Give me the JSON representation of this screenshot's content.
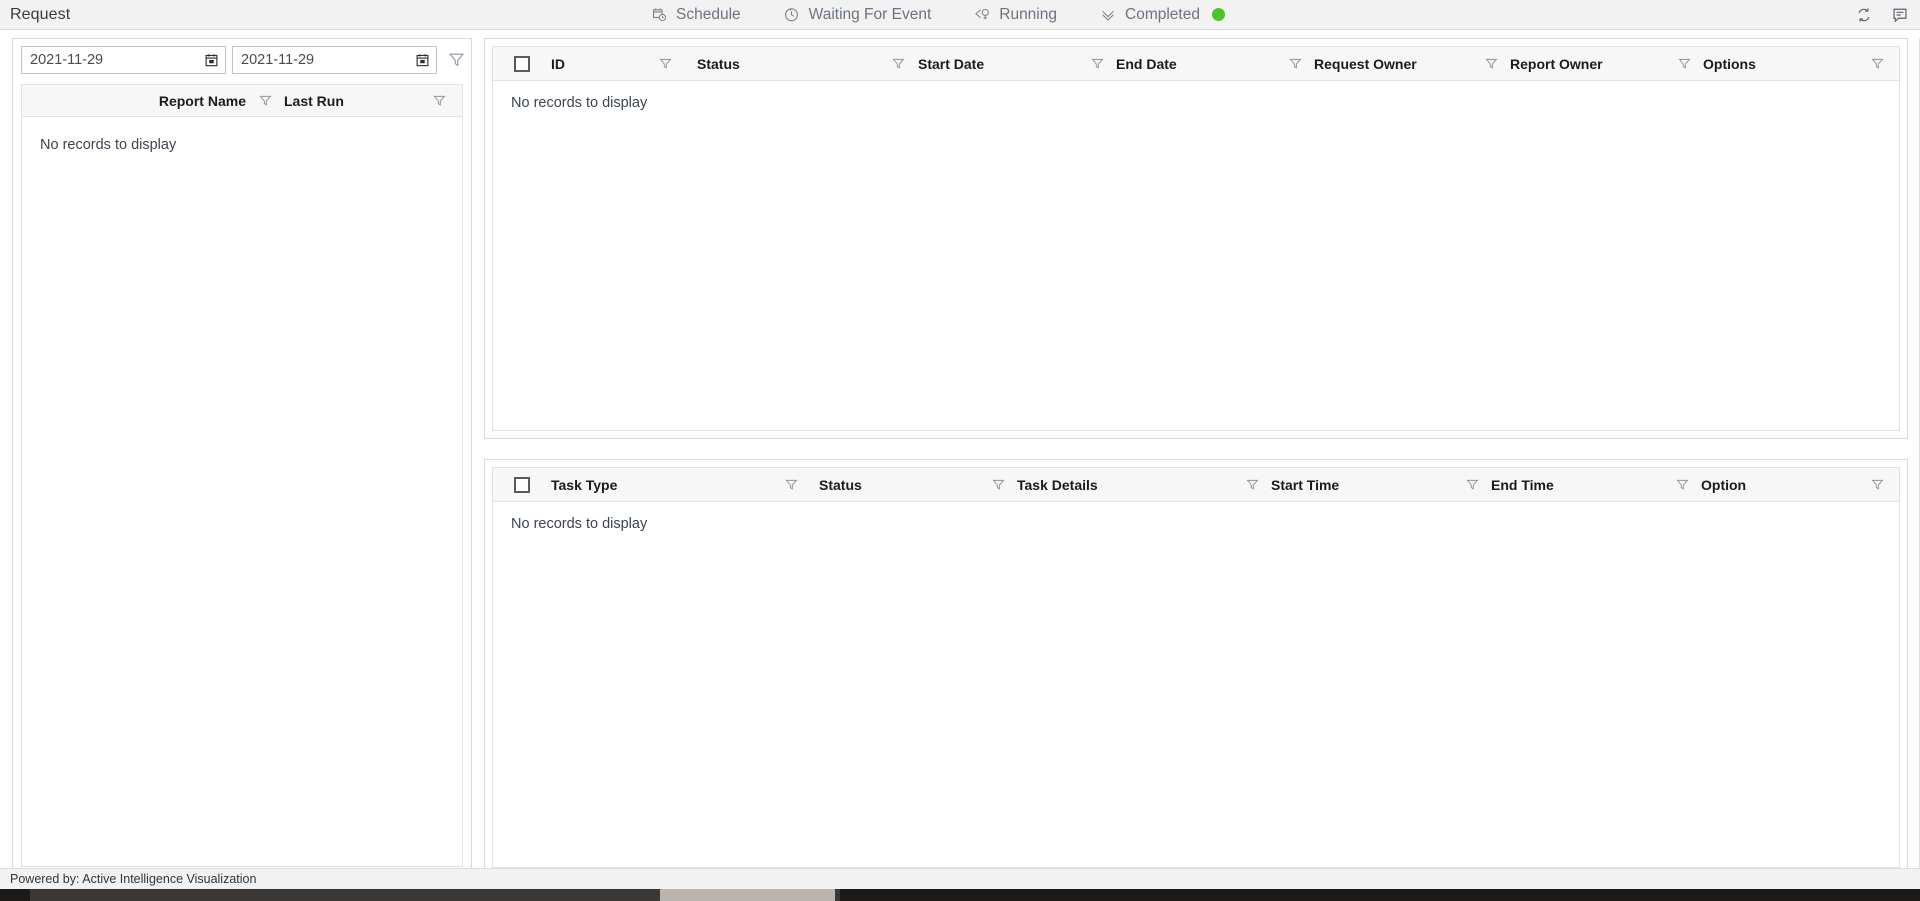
{
  "topbar": {
    "title": "Request",
    "tabs": [
      {
        "label": "Schedule",
        "icon": "calendar-clock-icon",
        "has_dot": false
      },
      {
        "label": "Waiting For Event",
        "icon": "clock-icon",
        "has_dot": false
      },
      {
        "label": "Running",
        "icon": "history-clock-icon",
        "has_dot": false
      },
      {
        "label": "Completed",
        "icon": "double-check-icon",
        "has_dot": true,
        "dot_color": "#4cc527"
      }
    ],
    "actions": [
      {
        "icon": "refresh-icon"
      },
      {
        "icon": "comment-icon"
      }
    ]
  },
  "left_panel": {
    "date_from": {
      "value": "2021-11-29",
      "placeholder": "yyyy-mm-dd"
    },
    "date_to": {
      "value": "2021-11-29",
      "placeholder": "yyyy-mm-dd"
    },
    "filter_icon": "filter-icon",
    "calendar_icon": "calendar-icon",
    "grid": {
      "columns": [
        {
          "label": "Report Name",
          "filter": true
        },
        {
          "label": "Last Run",
          "filter": true
        }
      ],
      "empty_text": "No records to display",
      "rows": []
    }
  },
  "request_grid": {
    "columns": [
      {
        "label": "ID",
        "filter": true
      },
      {
        "label": "Status",
        "filter": true
      },
      {
        "label": "Start Date",
        "filter": true
      },
      {
        "label": "End Date",
        "filter": true
      },
      {
        "label": "Request Owner",
        "filter": true
      },
      {
        "label": "Report Owner",
        "filter": true
      },
      {
        "label": "Options",
        "filter": true
      }
    ],
    "select_all_checkbox": false,
    "empty_text": "No records to display",
    "rows": []
  },
  "task_grid": {
    "columns": [
      {
        "label": "Task Type",
        "filter": true
      },
      {
        "label": "Status",
        "filter": true
      },
      {
        "label": "Task Details",
        "filter": true
      },
      {
        "label": "Start Time",
        "filter": true
      },
      {
        "label": "End Time",
        "filter": true
      },
      {
        "label": "Option",
        "filter": true
      }
    ],
    "select_all_checkbox": false,
    "empty_text": "No records to display",
    "rows": []
  },
  "footer": {
    "text": "Powered by: Active Intelligence Visualization"
  },
  "colors": {
    "accent_green": "#4cc527",
    "topbar_bg": "#f2f2f2",
    "header_bg": "#f7f7f7",
    "border": "#d9d9d9",
    "text": "#1b1b1b",
    "muted_text": "#6b7480"
  }
}
